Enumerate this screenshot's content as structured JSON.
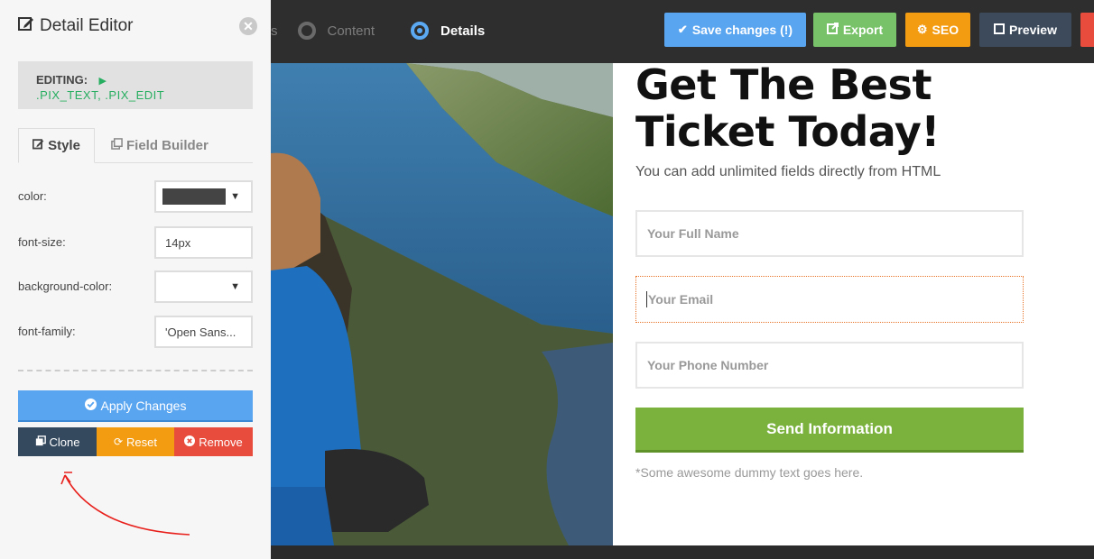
{
  "topbar": {
    "steps": [
      {
        "label": "s"
      },
      {
        "label": "Content"
      },
      {
        "label": "Details"
      }
    ],
    "buttons": {
      "save": "Save changes (!)",
      "export": "Export",
      "seo": "SEO",
      "preview": "Preview"
    },
    "colors": {
      "save": "#5aa5f0",
      "export": "#78c36a",
      "seo": "#f39c12",
      "preview": "#3c4a5c",
      "danger": "#e74c3c"
    }
  },
  "panel": {
    "title": "Detail Editor",
    "editing_label": "EDITING:",
    "editing_target": ".PIX_TEXT, .PIX_EDIT",
    "tabs": [
      {
        "label": "Style"
      },
      {
        "label": "Field Builder"
      }
    ],
    "properties": [
      {
        "label": "color:",
        "value": ""
      },
      {
        "label": "font-size:",
        "value": "14px"
      },
      {
        "label": "background-color:",
        "value": ""
      },
      {
        "label": "font-family:",
        "value": "'Open Sans..."
      }
    ],
    "apply": "Apply Changes",
    "clone": "Clone",
    "reset": "Reset",
    "remove": "Remove"
  },
  "page": {
    "headline": "Get The Best Ticket Today!",
    "subtext": "You can add unlimited fields directly from HTML",
    "fields": [
      {
        "placeholder": "Your Full Name"
      },
      {
        "placeholder": "Your Email"
      },
      {
        "placeholder": "Your Phone Number"
      }
    ],
    "submit": "Send Information",
    "footnote": "*Some awesome dummy text goes here."
  }
}
